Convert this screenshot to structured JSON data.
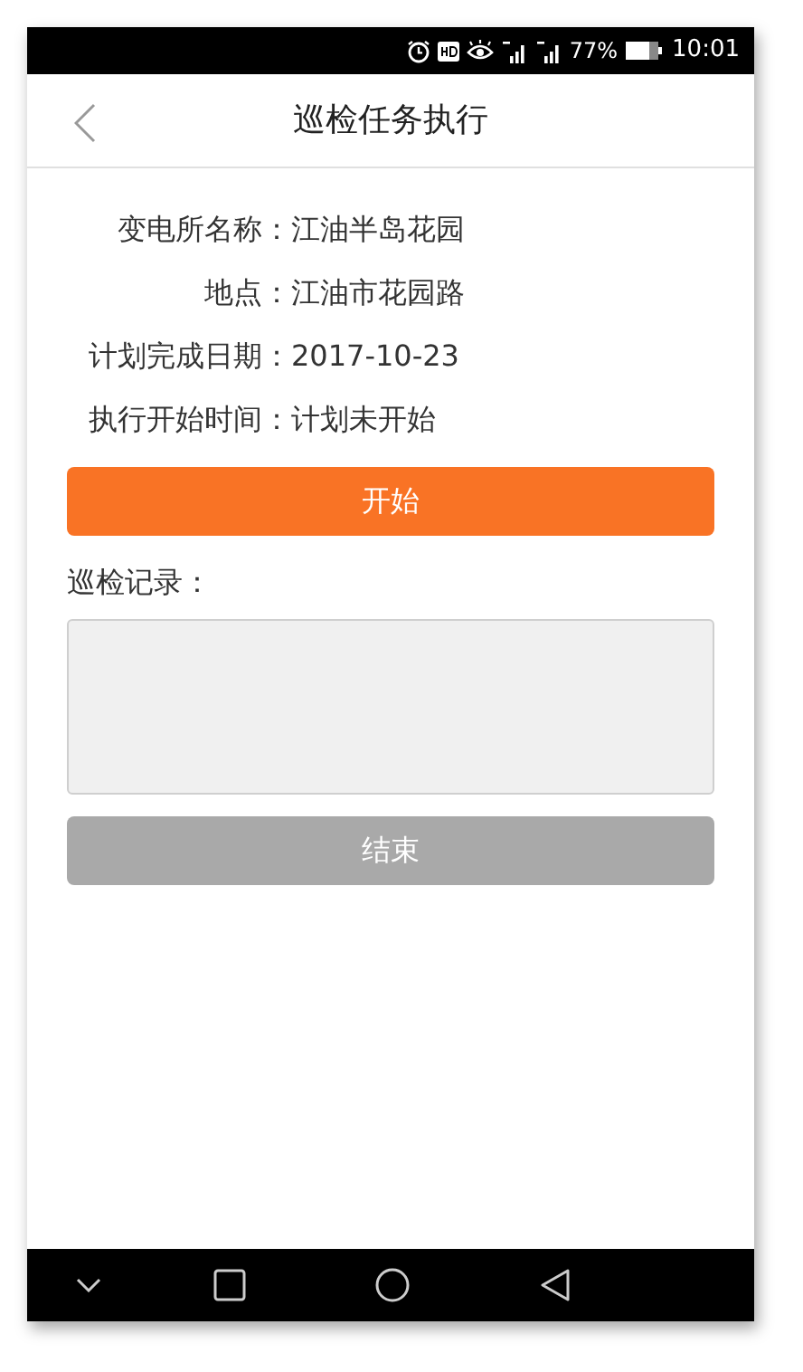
{
  "status_bar": {
    "battery": "77%",
    "time": "10:01"
  },
  "header": {
    "title": "巡检任务执行"
  },
  "fields": [
    {
      "label": "变电所名称：",
      "value": "江油半岛花园"
    },
    {
      "label": "地点：",
      "value": "江油市花园路"
    },
    {
      "label": "计划完成日期：",
      "value": "2017-10-23"
    },
    {
      "label": "执行开始时间：",
      "value": "计划未开始"
    }
  ],
  "start_button": {
    "label": "开始",
    "disabled": false
  },
  "record": {
    "label": "巡检记录："
  },
  "end_button": {
    "label": "结束",
    "disabled": true
  }
}
